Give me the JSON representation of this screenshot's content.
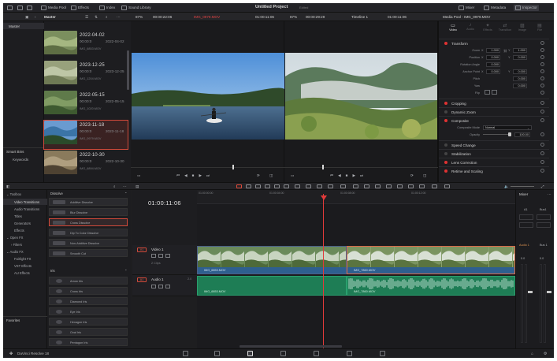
{
  "topbar": {
    "media_pool": "Media Pool",
    "effects": "Effects",
    "index": "Index",
    "sound_library": "Sound Library",
    "project_title": "Untitled Project",
    "project_status": "Edited",
    "mixer": "Mixer",
    "metadata": "Metadata",
    "inspector": "Inspector"
  },
  "bin_bar": {
    "bin_name": "Master",
    "left_zoom": "87%",
    "left_timecode": "00:00:22:06",
    "source_clip": "IMG_0979.MOV",
    "right_zoom": "87%",
    "right_timecode": "00:00:29:29",
    "timeline_name": "Timeline 1",
    "right_tc2": "01:00:11:06",
    "media_pool_title": "Media Pool - IMG_0979.MOV"
  },
  "sidebar": {
    "master_label": "Master",
    "smart_bins": "Smart Bins",
    "keywords": "Keywords"
  },
  "clips": [
    {
      "date": "2022-04-02",
      "time": "00:00:0",
      "time2": "2022-04-02",
      "name": "IMG_6853.MOV"
    },
    {
      "date": "2023-12-25",
      "time": "00:00:0",
      "time2": "2023-12-25",
      "name": "IMG_1204.MOV"
    },
    {
      "date": "2022-05-15",
      "time": "00:00:0",
      "time2": "2022-05-15",
      "name": "IMG_1020.MOV"
    },
    {
      "date": "2023-11-18",
      "time": "00:00:0",
      "time2": "2023-11-18",
      "name": "IMG_0979.MOV"
    },
    {
      "date": "2022-10-30",
      "time": "00:00:0",
      "time2": "2022-10-30",
      "name": "IMG_6894.MOV"
    }
  ],
  "inspector": {
    "tabs": [
      "Video",
      "Audio",
      "Effects",
      "Transition",
      "Image",
      "File"
    ],
    "transform": "Transform",
    "zoom_label": "Zoom",
    "zoom_x": "1.000",
    "zoom_y": "1.000",
    "position_label": "Position",
    "pos_x": "0.000",
    "pos_y": "0.000",
    "rotation_label": "Rotation Angle",
    "rotation": "0.000",
    "anchor_label": "Anchor Point",
    "anchor_x": "0.000",
    "anchor_y": "0.000",
    "pitch_label": "Pitch",
    "pitch": "0.000",
    "yaw_label": "Yaw",
    "yaw": "0.000",
    "flip_label": "Flip",
    "cropping": "Cropping",
    "dynamic_zoom": "Dynamic Zoom",
    "composite": "Composite",
    "comp_mode_label": "Composite Mode",
    "comp_mode": "Normal",
    "opacity_label": "Opacity",
    "opacity": "100.00",
    "speed_change": "Speed Change",
    "stabilization": "Stabilization",
    "lens_correction": "Lens Correction",
    "retime_scaling": "Retime and Scaling",
    "axis_x": "X",
    "axis_y": "Y"
  },
  "effects_tree": {
    "toolbox": "Toolbox",
    "video_transitions": "Video Transitions",
    "audio_transitions": "Audio Transitions",
    "titles": "Titles",
    "generators": "Generators",
    "effects": "Effects",
    "open_fx": "Open FX",
    "filters": "Filters",
    "audio_fx": "Audio FX",
    "fairlight_fx": "Fairlight FX",
    "vst_effects": "VST Effects",
    "au_effects": "AU Effects",
    "favorites": "Favorites"
  },
  "effects_list": {
    "header_dissolve": "Dissolve",
    "items": [
      "Additive Dissolve",
      "Blur Dissolve",
      "Cross Dissolve",
      "Dip To Color Dissolve",
      "Non-Additive Dissolve",
      "Smooth Cut"
    ],
    "header_iris": "Iris",
    "iris_items": [
      "Arrow Iris",
      "Cross Iris",
      "Diamond Iris",
      "Eye Iris",
      "Hexagon Iris",
      "Oval Iris",
      "Pentagon Iris"
    ]
  },
  "timeline": {
    "timecode": "01:00:11:06",
    "ruler": [
      "01:00:00:00",
      "01:00:04:00",
      "01:00:08:00",
      "01:00:12:00"
    ],
    "video_track_badge": "V1",
    "video_track_name": "Video 1",
    "video_track_count": "2 Clips",
    "audio_track_badge": "A1",
    "audio_track_name": "Audio 1",
    "audio_track_level": "2.0",
    "vclip1": "IMG_6853.MOV",
    "vclip2": "IMG_7860.MOV",
    "aclip1": "IMG_6853.MOV",
    "aclip2": "IMG_7860.MOV"
  },
  "mixer": {
    "title": "Mixer",
    "a1": "A1",
    "bus1": "Bus1",
    "audio1": "Audio 1",
    "bus1_b": "Bus 1",
    "value1": "0.0",
    "value2": "0.0"
  },
  "footer": {
    "app_name": "DaVinci Resolve 18"
  },
  "colors": {
    "accent_red": "#e03232",
    "clip_blue": "#2e5f8f",
    "clip_green": "#1e7d55",
    "playhead": "#e23a3a"
  }
}
